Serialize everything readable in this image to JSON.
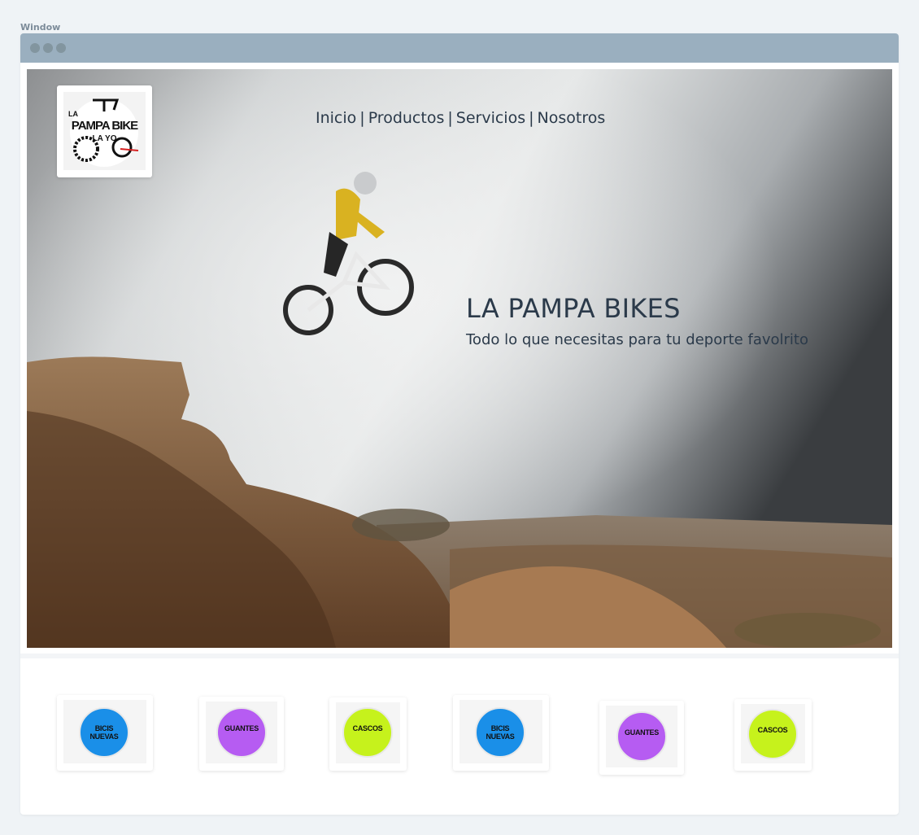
{
  "window": {
    "label": "Window"
  },
  "hero": {
    "logo": {
      "line1": "LA",
      "line2": "PAMPA BIKE",
      "line3": "LA YO"
    },
    "nav": [
      {
        "label": "Inicio"
      },
      {
        "label": "Productos"
      },
      {
        "label": "Servicios"
      },
      {
        "label": "Nosotros"
      }
    ],
    "nav_separator": "|",
    "title": "LA PAMPA BIKES",
    "subtitle": "Todo lo que necesitas para tu deporte favolrito"
  },
  "categories": [
    {
      "label": "BICIS NUEVAS",
      "color": "#1a8fe8"
    },
    {
      "label": "GUANTES",
      "color": "#b65cf2"
    },
    {
      "label": "CASCOS",
      "color": "#c6f21c"
    },
    {
      "label": "BICIS NUEVAS",
      "color": "#1a8fe8"
    },
    {
      "label": "GUANTES",
      "color": "#b65cf2"
    },
    {
      "label": "CASCOS",
      "color": "#c6f21c"
    }
  ]
}
